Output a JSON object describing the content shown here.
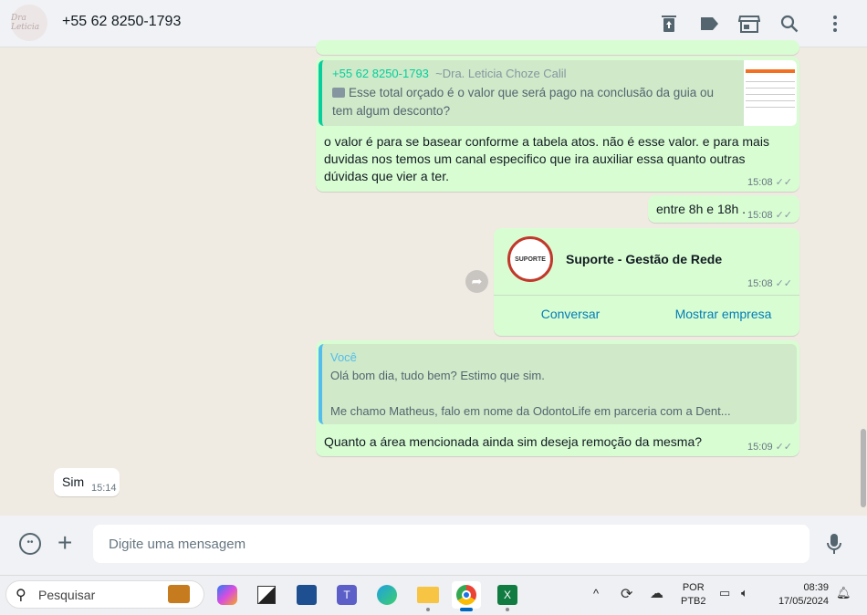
{
  "header": {
    "avatar_text": "Dra Leticia",
    "title": "+55 62 8250-1793"
  },
  "messages": [
    {
      "type": "reply",
      "quote_sender": "+55 62 8250-1793",
      "quote_name": "~Dra. Leticia Choze Calil",
      "quote_text": "Esse total orçado é o valor que será pago na conclusão da guia ou tem algum desconto?",
      "text": "o valor é para se basear conforme a tabela atos. não é esse valor. e para mais duvidas nos temos um canal especifico que ira auxiliar essa quanto outras dúvidas que vier a ter.",
      "time": "15:08"
    },
    {
      "type": "text",
      "text": "entre 8h e 18h .",
      "time": "15:08"
    },
    {
      "type": "contact",
      "logo_text": "SUPORTE",
      "name": "Suporte - Gestão de Rede",
      "time": "15:08",
      "action1": "Conversar",
      "action2": "Mostrar empresa"
    },
    {
      "type": "reply",
      "quote_sender": "Você",
      "quote_line1": "Olá bom dia, tudo bem? Estimo que sim.",
      "quote_line2": "Me chamo Matheus, falo em nome da OdontoLife em parceria com a Dent...",
      "text": "Quanto a área mencionada ainda sim deseja remoção da mesma?",
      "time": "15:09"
    },
    {
      "type": "incoming",
      "text": "Sim",
      "time": "15:14"
    }
  ],
  "composer": {
    "placeholder": "Digite uma mensagem"
  },
  "taskbar": {
    "search": "Pesquisar",
    "lang1": "POR",
    "lang2": "PTB2",
    "time": "08:39",
    "date": "17/05/2024"
  },
  "colors": {
    "outgoing": "#d9fdd3",
    "accent": "#06cf9c",
    "link": "#027eb5"
  }
}
